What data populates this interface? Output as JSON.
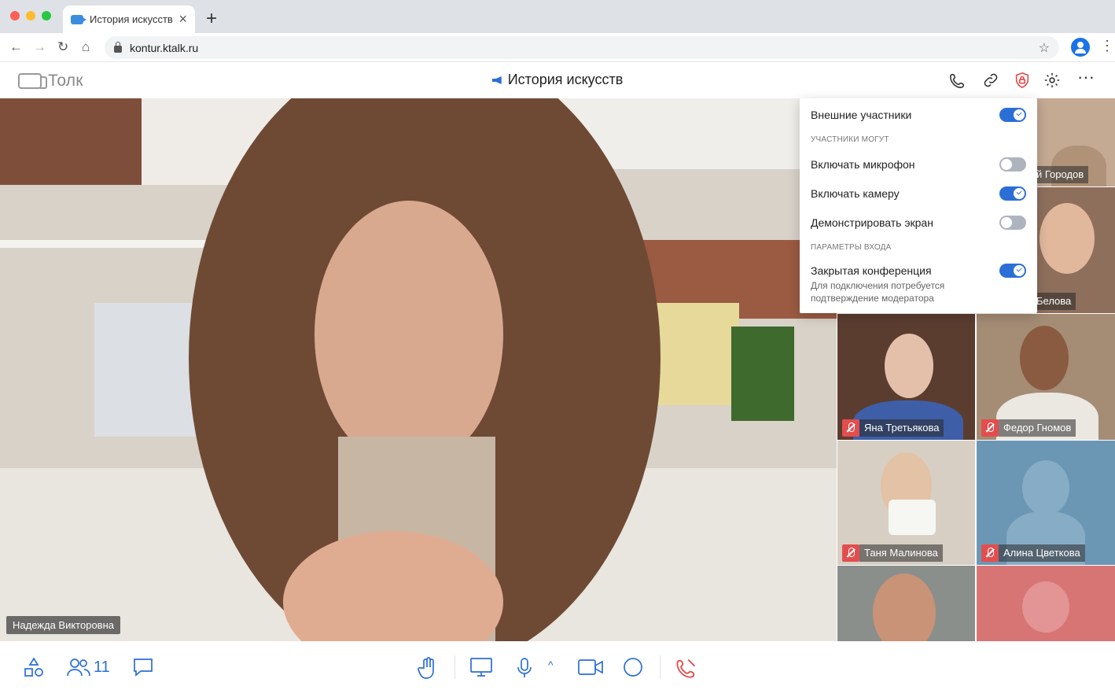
{
  "browser": {
    "tab_title": "История искусств",
    "tab_close": "×",
    "new_tab": "+",
    "url": "kontur.ktalk.ru",
    "back": "←",
    "forward": "→",
    "reload": "↻",
    "home": "⌂",
    "star": "☆",
    "menu": "⋮"
  },
  "app": {
    "logo_text": "Толк",
    "conference_title": "История искусств",
    "header_more": "···"
  },
  "main_speaker": {
    "name": "Надежда Викторовна"
  },
  "participants": [
    {
      "name": "й Городов",
      "muted": false,
      "bg": "#b59a86"
    },
    {
      "name": "Белова",
      "muted": false,
      "bg": "#a27d67"
    },
    {
      "name": "Яна Третьякова",
      "muted": true,
      "bg": "#6b4c3e"
    },
    {
      "name": "Федор Гномов",
      "muted": true,
      "bg": "#7d5a46"
    },
    {
      "name": "Таня Малинова",
      "muted": true,
      "bg": "#c8b59f"
    },
    {
      "name": "Алина Цветкова",
      "muted": true,
      "bg": "#6b97b5"
    },
    {
      "name": "",
      "muted": false,
      "bg": "#8a8f8c"
    },
    {
      "name": "",
      "muted": false,
      "bg": "#d77575"
    }
  ],
  "settings_popup": {
    "external_participants": {
      "label": "Внешние участники",
      "on": true
    },
    "section_can": "УЧАСТНИКИ МОГУТ",
    "enable_mic": {
      "label": "Включать микрофон",
      "on": false
    },
    "enable_camera": {
      "label": "Включать камеру",
      "on": true
    },
    "share_screen": {
      "label": "Демонстрировать экран",
      "on": false
    },
    "section_entry": "ПАРАМЕТРЫ ВХОДА",
    "closed_conference": {
      "label": "Закрытая конференция",
      "on": true,
      "hint": "Для подключения потребуется подтверждение модератора"
    }
  },
  "toolbar": {
    "participants_count": "11",
    "mic_caret": "^"
  },
  "colors": {
    "accent": "#2b6fd6",
    "danger": "#e24e4e"
  }
}
